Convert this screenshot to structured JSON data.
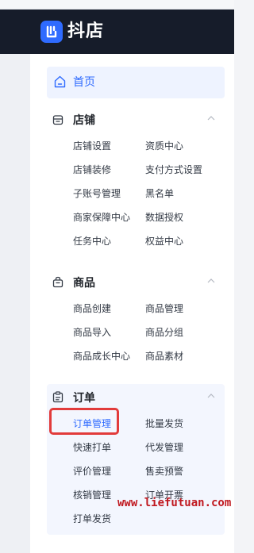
{
  "brand": {
    "name": "抖店"
  },
  "nav": {
    "home": {
      "label": "首页",
      "icon": "home-icon"
    },
    "sections": {
      "store": {
        "title": "店铺",
        "icon": "store-icon",
        "items": [
          "店铺设置",
          "资质中心",
          "店铺装修",
          "支付方式设置",
          "子账号管理",
          "黑名单",
          "商家保障中心",
          "数据授权",
          "任务中心",
          "权益中心"
        ]
      },
      "goods": {
        "title": "商品",
        "icon": "bag-icon",
        "items": [
          "商品创建",
          "商品管理",
          "商品导入",
          "商品分组",
          "商品成长中心",
          "商品素材"
        ]
      },
      "orders": {
        "title": "订单",
        "icon": "clipboard-icon",
        "items": [
          "订单管理",
          "批量发货",
          "快速打单",
          "代发管理",
          "评价管理",
          "售卖预警",
          "核销管理",
          "订单开票",
          "打单发货"
        ],
        "active_item": "订单管理"
      }
    }
  },
  "watermark": "www.liefutuan.com",
  "colors": {
    "accent": "#2f6bff",
    "header_bg": "#161c2a",
    "highlight": "#e23b3b"
  }
}
